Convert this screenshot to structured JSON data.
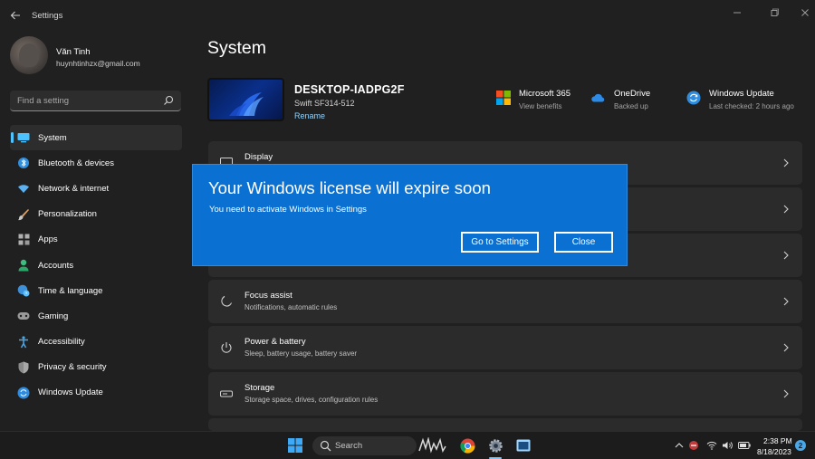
{
  "window": {
    "title": "Settings",
    "back_icon": "back-arrow-icon",
    "controls": [
      "minimize-icon",
      "maximize-icon",
      "close-icon"
    ]
  },
  "profile": {
    "name": "Văn Tinh",
    "email": "huynhtinhzx@gmail.com"
  },
  "search": {
    "placeholder": "Find a setting",
    "icon": "search-icon"
  },
  "sidebar": {
    "items": [
      {
        "label": "System",
        "icon": "system-icon",
        "active": true
      },
      {
        "label": "Bluetooth & devices",
        "icon": "bluetooth-icon"
      },
      {
        "label": "Network & internet",
        "icon": "wifi-icon"
      },
      {
        "label": "Personalization",
        "icon": "brush-icon"
      },
      {
        "label": "Apps",
        "icon": "apps-icon"
      },
      {
        "label": "Accounts",
        "icon": "person-icon"
      },
      {
        "label": "Time & language",
        "icon": "globe-clock-icon"
      },
      {
        "label": "Gaming",
        "icon": "gamepad-icon"
      },
      {
        "label": "Accessibility",
        "icon": "accessibility-icon"
      },
      {
        "label": "Privacy & security",
        "icon": "shield-icon"
      },
      {
        "label": "Windows Update",
        "icon": "update-icon"
      }
    ]
  },
  "main": {
    "title": "System",
    "device": {
      "name": "DESKTOP-IADPG2F",
      "model": "Swift SF314-512",
      "rename": "Rename"
    },
    "quick_links": [
      {
        "title": "Microsoft 365",
        "subtitle": "View benefits",
        "icon": "microsoft-365-icon"
      },
      {
        "title": "OneDrive",
        "subtitle": "Backed up",
        "icon": "onedrive-icon"
      },
      {
        "title": "Windows Update",
        "subtitle": "Last checked: 2 hours ago",
        "icon": "windows-update-icon"
      }
    ],
    "cards": [
      {
        "title": "Display",
        "subtitle": "",
        "icon": "display-icon"
      },
      {
        "title": "",
        "subtitle": "",
        "icon": ""
      },
      {
        "title": "",
        "subtitle": "",
        "icon": ""
      },
      {
        "title": "Focus assist",
        "subtitle": "Notifications, automatic rules",
        "icon": "moon-icon"
      },
      {
        "title": "Power & battery",
        "subtitle": "Sleep, battery usage, battery saver",
        "icon": "power-icon"
      },
      {
        "title": "Storage",
        "subtitle": "Storage space, drives, configuration rules",
        "icon": "storage-icon"
      }
    ]
  },
  "dialog": {
    "title": "Your Windows license will expire soon",
    "message": "You need to activate Windows in Settings",
    "primary_button": "Go to Settings",
    "secondary_button": "Close",
    "background": "#0a70d2"
  },
  "taskbar": {
    "search_placeholder": "Search",
    "apps": [
      "windows-start-icon",
      "search-icon",
      "pinned-app-icon",
      "chrome-icon",
      "settings-gear-icon",
      "window-app-icon"
    ],
    "tray": [
      "chevron-up-icon",
      "red-app-icon",
      "wifi-icon",
      "volume-icon",
      "battery-icon"
    ],
    "time": "2:38 PM",
    "date": "8/18/2023",
    "notifications": "2"
  },
  "colors": {
    "background": "#202020",
    "card": "#2b2b2b",
    "accent": "#4cc2ff",
    "dialog": "#0a70d2"
  }
}
